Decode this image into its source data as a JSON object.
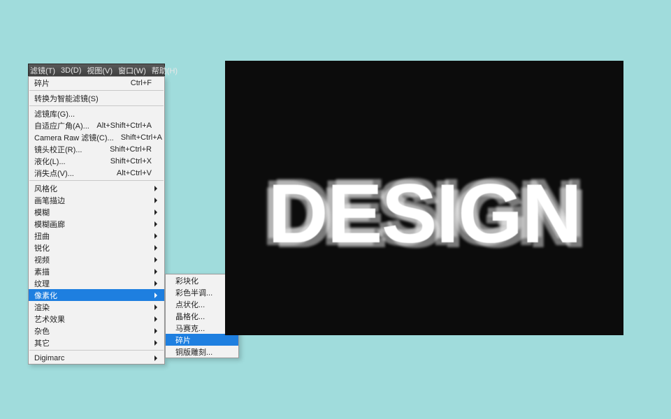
{
  "menubar": {
    "items": [
      "滤镜(T)",
      "3D(D)",
      "视图(V)",
      "窗口(W)",
      "帮助(H)"
    ]
  },
  "menu": {
    "section0": [
      {
        "label": "碎片",
        "shortcut": "Ctrl+F"
      }
    ],
    "section1": [
      {
        "label": "转换为智能滤镜(S)"
      }
    ],
    "section2": [
      {
        "label": "滤镜库(G)..."
      },
      {
        "label": "自适应广角(A)...",
        "shortcut": "Alt+Shift+Ctrl+A"
      },
      {
        "label": "Camera Raw 滤镜(C)...",
        "shortcut": "Shift+Ctrl+A"
      },
      {
        "label": "镜头校正(R)...",
        "shortcut": "Shift+Ctrl+R"
      },
      {
        "label": "液化(L)...",
        "shortcut": "Shift+Ctrl+X"
      },
      {
        "label": "消失点(V)...",
        "shortcut": "Alt+Ctrl+V"
      }
    ],
    "section3": [
      {
        "label": "风格化",
        "sub": true
      },
      {
        "label": "画笔描边",
        "sub": true
      },
      {
        "label": "模糊",
        "sub": true
      },
      {
        "label": "模糊画廊",
        "sub": true
      },
      {
        "label": "扭曲",
        "sub": true
      },
      {
        "label": "锐化",
        "sub": true
      },
      {
        "label": "视频",
        "sub": true
      },
      {
        "label": "素描",
        "sub": true
      },
      {
        "label": "纹理",
        "sub": true
      },
      {
        "label": "像素化",
        "sub": true,
        "selected": true
      },
      {
        "label": "渲染",
        "sub": true
      },
      {
        "label": "艺术效果",
        "sub": true
      },
      {
        "label": "杂色",
        "sub": true
      },
      {
        "label": "其它",
        "sub": true
      }
    ],
    "section4": [
      {
        "label": "Digimarc",
        "sub": true
      }
    ]
  },
  "submenu": {
    "items": [
      {
        "label": "彩块化"
      },
      {
        "label": "彩色半调..."
      },
      {
        "label": "点状化..."
      },
      {
        "label": "晶格化..."
      },
      {
        "label": "马赛克..."
      },
      {
        "label": "碎片",
        "selected": true
      },
      {
        "label": "铜版雕刻..."
      }
    ]
  },
  "preview": {
    "text": "DESIGN"
  }
}
